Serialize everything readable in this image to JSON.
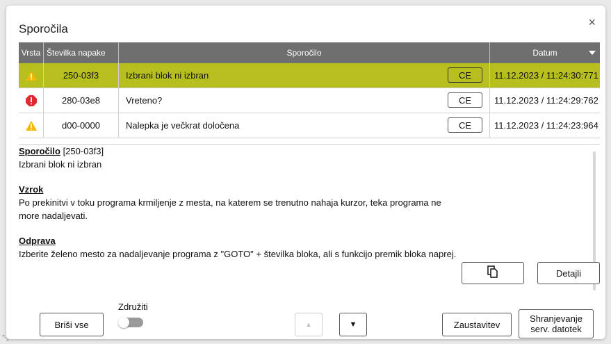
{
  "dialog": {
    "title": "Sporočila",
    "close_glyph": "×"
  },
  "table": {
    "headers": {
      "type": "Vrsta",
      "number": "Številka napake",
      "message": "Sporočilo",
      "date": "Datum"
    },
    "rows": [
      {
        "icon": "warning-icon",
        "number": "250-03f3",
        "message": "Izbrani blok ni izbran",
        "ce": "CE",
        "date": "11.12.2023 / 11:24:30:771",
        "selected": true
      },
      {
        "icon": "error-icon",
        "number": "280-03e8",
        "message": "Vreteno?",
        "ce": "CE",
        "date": "11.12.2023 / 11:24:29:762",
        "selected": false
      },
      {
        "icon": "warning-icon",
        "number": "d00-0000",
        "message": "Nalepka je večkrat določena",
        "ce": "CE",
        "date": "11.12.2023 / 11:24:23:964",
        "selected": false
      }
    ]
  },
  "detail": {
    "msg_heading": "Sporočilo",
    "msg_code": " [250-03f3]",
    "msg_text": "Izbrani blok ni izbran",
    "cause_heading": "Vzrok",
    "cause_text": "Po prekinitvi v toku programa krmiljenje z mesta, na katerem se trenutno nahaja kurzor, teka programa ne more nadaljevati.",
    "fix_heading": "Odprava",
    "fix_text": "Izberite želeno mesto za nadaljevanje programa z \"GOTO\" + številka bloka, ali s funkcijo premik bloka naprej.",
    "details_label": "Detajli"
  },
  "footer": {
    "delete_all": "Briši vse",
    "merge_label": "Združiti",
    "pause": "Zaustavitev",
    "save_service": "Shranjevanje serv. datotek"
  },
  "colors": {
    "accent": "#b7bf1f",
    "warning": "#f5b800",
    "error": "#e0282d",
    "header_bg": "#6f6f6f"
  }
}
